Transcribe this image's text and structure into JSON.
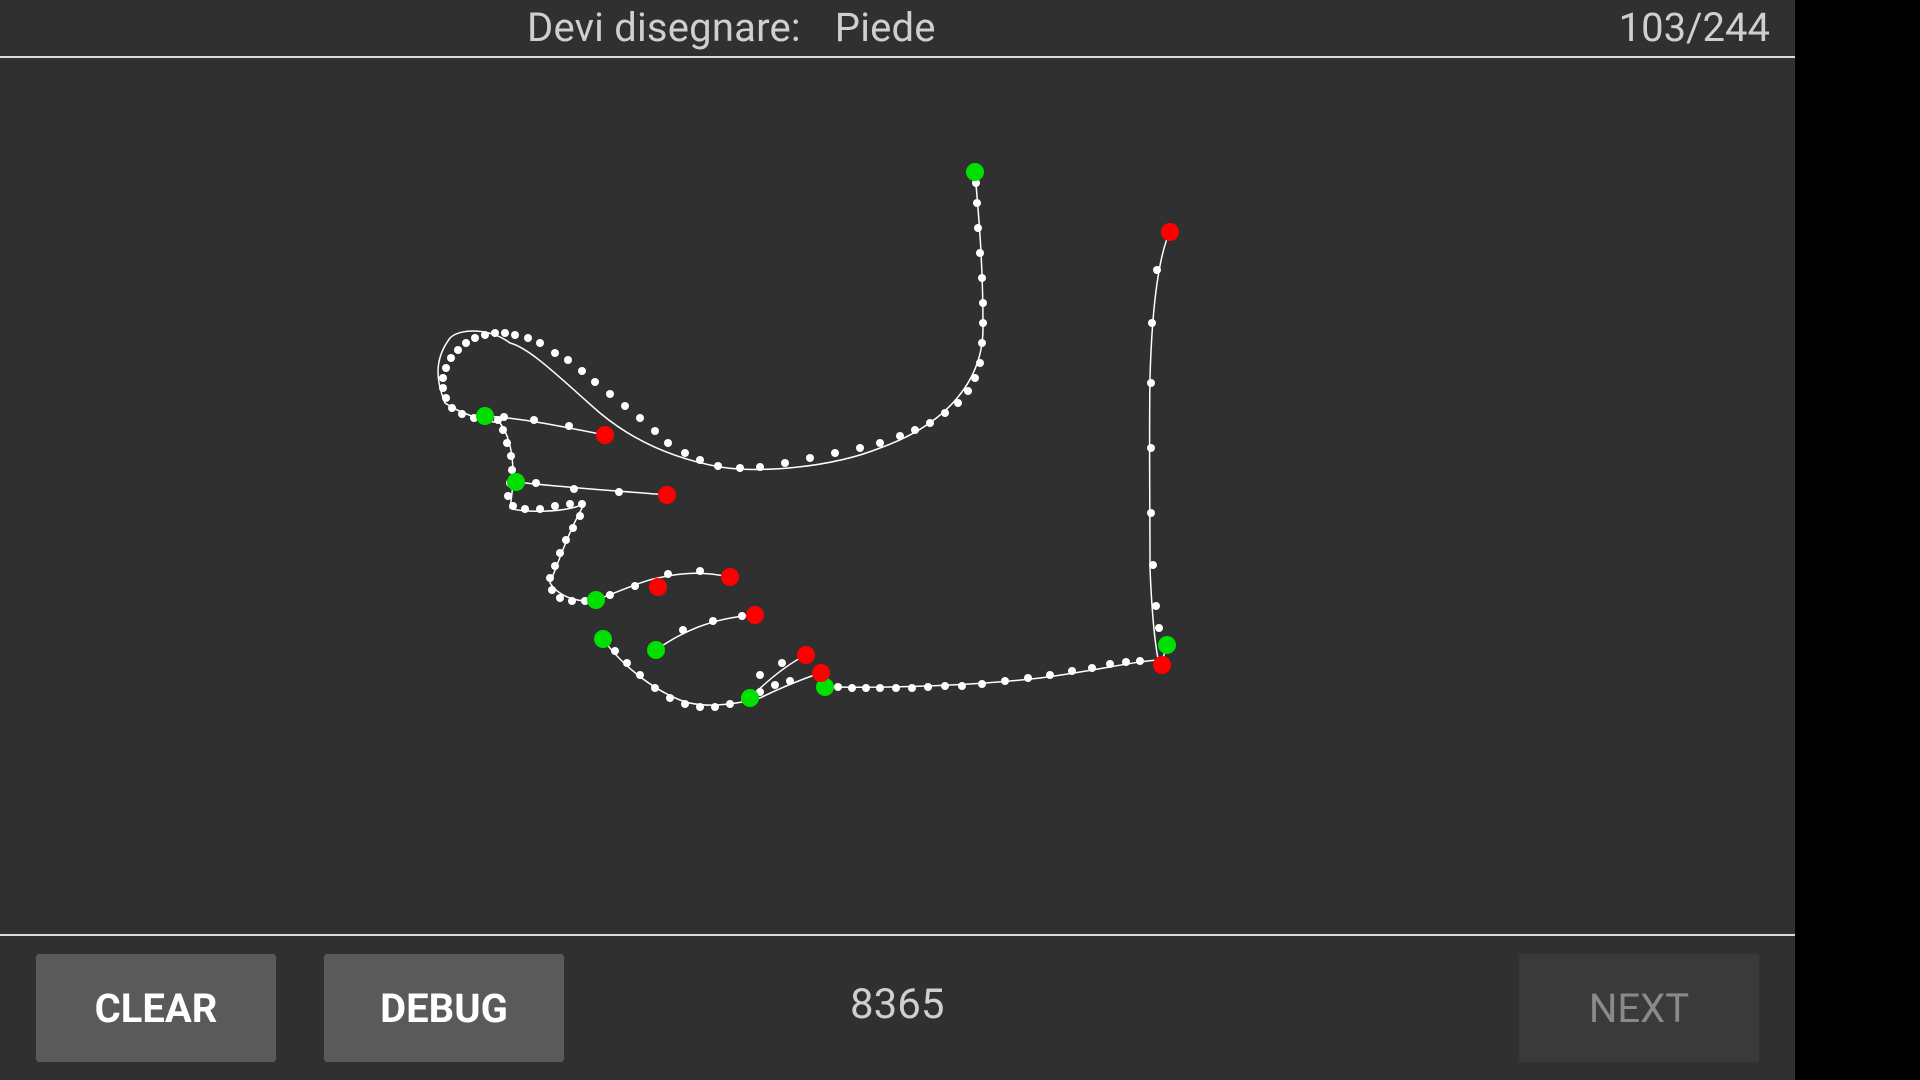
{
  "header": {
    "prompt_label": "Devi disegnare:",
    "target_word": "Piede",
    "progress": "103/244"
  },
  "footer": {
    "clear_label": "CLEAR",
    "debug_label": "DEBUG",
    "score": "8365",
    "next_label": "NEXT"
  },
  "colors": {
    "background": "#303030",
    "stroke": "#ffffff",
    "stroke_start": "#00e000",
    "stroke_end": "#ff0000"
  }
}
